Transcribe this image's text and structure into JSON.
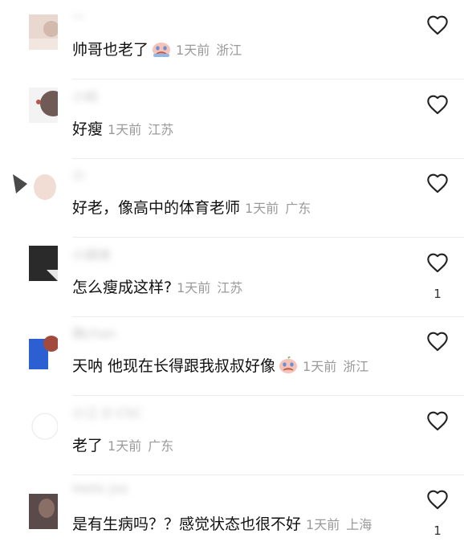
{
  "comments": [
    {
      "username": "一",
      "text": "帅哥也老了",
      "time": "1天前",
      "location": "浙江",
      "emoji": "crying-face-icon",
      "likes": ""
    },
    {
      "username": "小蚂",
      "text": "好瘦",
      "time": "1天前",
      "location": "江苏",
      "emoji": "",
      "likes": ""
    },
    {
      "username": "小",
      "text": "好老，像高中的体育老师",
      "time": "1天前",
      "location": "广东",
      "emoji": "",
      "likes": ""
    },
    {
      "username": "小嫣侠",
      "text": "怎么瘦成这样?",
      "time": "1天前",
      "location": "江苏",
      "emoji": "",
      "likes": "1"
    },
    {
      "username": "微chan",
      "text": "天呐 他现在长得跟我叔叔好像",
      "time": "1天前",
      "location": "浙江",
      "emoji": "crying-face-icon",
      "likes": ""
    },
    {
      "username": "小江 D CSC",
      "text": "老了",
      "time": "1天前",
      "location": "广东",
      "emoji": "",
      "likes": ""
    },
    {
      "username": "Hello joo",
      "text": "是有生病吗？？感觉状态也很不好",
      "time": "1天前",
      "location": "上海",
      "emoji": "",
      "likes": "1"
    }
  ],
  "icons": {
    "like": "heart-outline-icon"
  },
  "colors": {
    "text": "#111111",
    "meta": "#9a9a9a",
    "divider": "#ececec"
  }
}
